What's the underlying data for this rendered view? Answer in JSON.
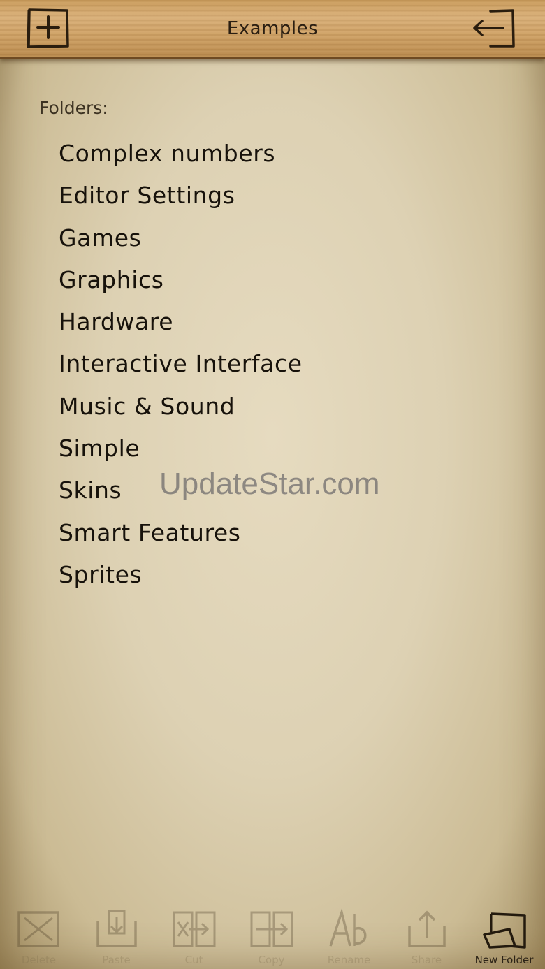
{
  "header": {
    "title": "Examples",
    "add_icon": "add-document-icon",
    "exit_icon": "exit-arrow-icon"
  },
  "content": {
    "section_label": "Folders:",
    "folders": [
      "Complex numbers",
      "Editor Settings",
      "Games",
      "Graphics",
      "Hardware",
      "Interactive Interface",
      "Music & Sound",
      "Simple",
      "Skins",
      "Smart Features",
      "Sprites"
    ]
  },
  "watermark": "UpdateStar.com",
  "toolbar": {
    "items": [
      {
        "label": "Delete",
        "icon": "delete-icon",
        "enabled": false
      },
      {
        "label": "Paste",
        "icon": "paste-icon",
        "enabled": false
      },
      {
        "label": "Cut",
        "icon": "cut-icon",
        "enabled": false
      },
      {
        "label": "Copy",
        "icon": "copy-icon",
        "enabled": false
      },
      {
        "label": "Rename",
        "icon": "rename-icon",
        "enabled": false
      },
      {
        "label": "Share",
        "icon": "share-icon",
        "enabled": false
      },
      {
        "label": "New Folder",
        "icon": "new-folder-icon",
        "enabled": true
      }
    ]
  },
  "colors": {
    "paper": "#ddd1b3",
    "wood": "#cfa267",
    "ink": "#17120b"
  }
}
